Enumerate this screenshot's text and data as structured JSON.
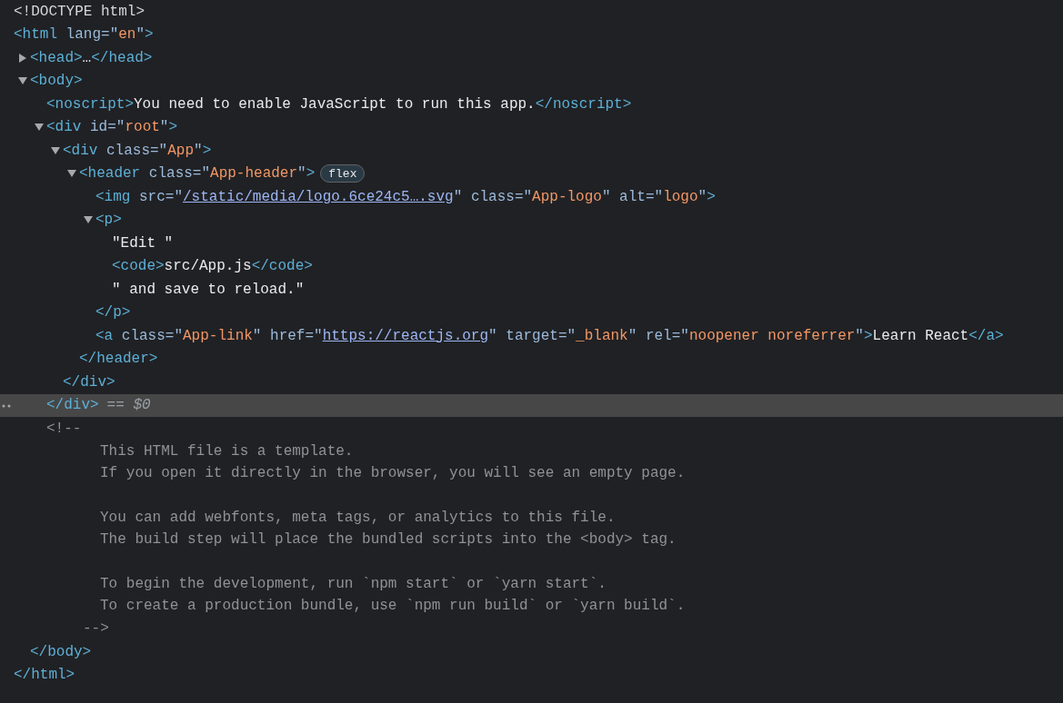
{
  "lines": [
    {
      "selected": false,
      "tokens": [
        {
          "kind": "doctype",
          "t": "<!DOCTYPE html>"
        }
      ]
    },
    {
      "selected": false,
      "tokens": [
        {
          "kind": "tag",
          "t": "<html"
        },
        {
          "kind": "attr",
          "t": " lang=\""
        },
        {
          "kind": "value",
          "t": "en"
        },
        {
          "kind": "attr",
          "t": "\""
        },
        {
          "kind": "tag",
          "t": ">"
        }
      ],
      "children": [
        {
          "selected": false,
          "expanded": false,
          "tokens": [
            {
              "kind": "tag",
              "t": "<head>"
            },
            {
              "kind": "text",
              "t": "…"
            },
            {
              "kind": "tag",
              "t": "</head>"
            }
          ]
        },
        {
          "selected": false,
          "expanded": true,
          "tokens": [
            {
              "kind": "tag",
              "t": "<body>"
            }
          ],
          "children": [
            {
              "selected": false,
              "tokens": [
                {
                  "kind": "tag",
                  "t": "<noscript>"
                },
                {
                  "kind": "text",
                  "t": "You need to enable JavaScript to run this app."
                },
                {
                  "kind": "tag",
                  "t": "</noscript>"
                }
              ]
            },
            {
              "selected": false,
              "expanded": true,
              "tokens": [
                {
                  "kind": "tag",
                  "t": "<div"
                },
                {
                  "kind": "attr",
                  "t": " id=\""
                },
                {
                  "kind": "value",
                  "t": "root"
                },
                {
                  "kind": "attr",
                  "t": "\""
                },
                {
                  "kind": "tag",
                  "t": ">"
                }
              ],
              "children": [
                {
                  "selected": false,
                  "expanded": true,
                  "tokens": [
                    {
                      "kind": "tag",
                      "t": "<div"
                    },
                    {
                      "kind": "attr",
                      "t": " class=\""
                    },
                    {
                      "kind": "value",
                      "t": "App"
                    },
                    {
                      "kind": "attr",
                      "t": "\""
                    },
                    {
                      "kind": "tag",
                      "t": ">"
                    }
                  ],
                  "children": [
                    {
                      "selected": false,
                      "expanded": true,
                      "badge": "flex",
                      "tokens": [
                        {
                          "kind": "tag",
                          "t": "<header"
                        },
                        {
                          "kind": "attr",
                          "t": " class=\""
                        },
                        {
                          "kind": "value",
                          "t": "App-header"
                        },
                        {
                          "kind": "attr",
                          "t": "\""
                        },
                        {
                          "kind": "tag",
                          "t": ">"
                        }
                      ],
                      "children": [
                        {
                          "selected": false,
                          "tokens": [
                            {
                              "kind": "tag",
                              "t": "<img"
                            },
                            {
                              "kind": "attr",
                              "t": " src=\""
                            },
                            {
                              "kind": "link",
                              "t": "/static/media/logo.6ce24c5….svg"
                            },
                            {
                              "kind": "attr",
                              "t": "\" class=\""
                            },
                            {
                              "kind": "value",
                              "t": "App-logo"
                            },
                            {
                              "kind": "attr",
                              "t": "\" alt=\""
                            },
                            {
                              "kind": "value",
                              "t": "logo"
                            },
                            {
                              "kind": "attr",
                              "t": "\""
                            },
                            {
                              "kind": "tag",
                              "t": ">"
                            }
                          ]
                        },
                        {
                          "selected": false,
                          "expanded": true,
                          "tokens": [
                            {
                              "kind": "tag",
                              "t": "<p>"
                            }
                          ],
                          "children": [
                            {
                              "selected": false,
                              "tokens": [
                                {
                                  "kind": "text",
                                  "t": "\"Edit \""
                                }
                              ]
                            },
                            {
                              "selected": false,
                              "tokens": [
                                {
                                  "kind": "tag",
                                  "t": "<code>"
                                },
                                {
                                  "kind": "text",
                                  "t": "src/App.js"
                                },
                                {
                                  "kind": "tag",
                                  "t": "</code>"
                                }
                              ]
                            },
                            {
                              "selected": false,
                              "tokens": [
                                {
                                  "kind": "text",
                                  "t": "\" and save to reload.\""
                                }
                              ]
                            }
                          ]
                        },
                        {
                          "selected": false,
                          "tokens": [
                            {
                              "kind": "tag",
                              "t": "</p>"
                            }
                          ]
                        },
                        {
                          "selected": false,
                          "tokens": [
                            {
                              "kind": "tag",
                              "t": "<a"
                            },
                            {
                              "kind": "attr",
                              "t": " class=\""
                            },
                            {
                              "kind": "value",
                              "t": "App-link"
                            },
                            {
                              "kind": "attr",
                              "t": "\" href=\""
                            },
                            {
                              "kind": "link",
                              "t": "https://reactjs.org"
                            },
                            {
                              "kind": "attr",
                              "t": "\" target=\""
                            },
                            {
                              "kind": "value",
                              "t": "_blank"
                            },
                            {
                              "kind": "attr",
                              "t": "\" rel=\""
                            },
                            {
                              "kind": "value",
                              "t": "noopener noreferrer"
                            },
                            {
                              "kind": "attr",
                              "t": "\""
                            },
                            {
                              "kind": "tag",
                              "t": ">"
                            },
                            {
                              "kind": "text",
                              "t": "Learn React"
                            },
                            {
                              "kind": "tag",
                              "t": "</a>"
                            }
                          ]
                        }
                      ]
                    },
                    {
                      "selected": false,
                      "tokens": [
                        {
                          "kind": "tag",
                          "t": "</header>"
                        }
                      ]
                    }
                  ]
                },
                {
                  "selected": false,
                  "tokens": [
                    {
                      "kind": "tag",
                      "t": "</div>"
                    }
                  ]
                }
              ]
            },
            {
              "selected": true,
              "note": "== $0",
              "tokens": [
                {
                  "kind": "tag",
                  "t": "</div>"
                }
              ]
            },
            {
              "selected": false,
              "comment": {
                "open": "<!--",
                "paragraphs": [
                  [
                    "This HTML file is a template.",
                    "If you open it directly in the browser, you will see an empty page."
                  ],
                  [
                    "You can add webfonts, meta tags, or analytics to this file.",
                    "The build step will place the bundled scripts into the <body> tag."
                  ],
                  [
                    "To begin the development, run `npm start` or `yarn start`.",
                    "To create a production bundle, use `npm run build` or `yarn build`."
                  ]
                ],
                "close": "-->"
              }
            }
          ]
        },
        {
          "selected": false,
          "tokens": [
            {
              "kind": "tag",
              "t": "</body>"
            }
          ]
        }
      ]
    },
    {
      "selected": false,
      "tokens": [
        {
          "kind": "tag",
          "t": "</html>"
        }
      ]
    }
  ]
}
